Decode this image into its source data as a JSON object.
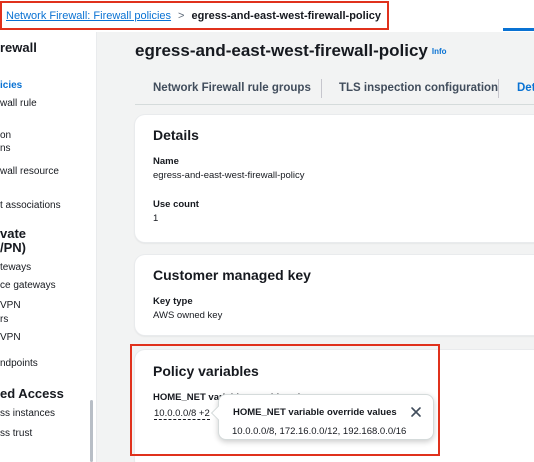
{
  "breadcrumb": {
    "parent_label": "Network Firewall: Firewall policies",
    "separator": ">",
    "current_label": "egress-and-east-west-firewall-policy"
  },
  "sidebar": {
    "items": [
      {
        "label": "rewall"
      },
      {
        "label": "icies"
      },
      {
        "label": "wall rule"
      },
      {
        "label": "on"
      },
      {
        "label": "ns"
      },
      {
        "label": "wall resource"
      },
      {
        "label": "t associations"
      },
      {
        "label": "vate"
      },
      {
        "label": "/PN)"
      },
      {
        "label": "teways"
      },
      {
        "label": "ce gateways"
      },
      {
        "label": "VPN"
      },
      {
        "label": "rs"
      },
      {
        "label": "VPN"
      },
      {
        "label": "ndpoints"
      },
      {
        "label": "ed Access"
      },
      {
        "label": "ss instances"
      },
      {
        "label": "ss trust"
      }
    ]
  },
  "page": {
    "title": "egress-and-east-west-firewall-policy",
    "info_link": "Info"
  },
  "tabs": [
    {
      "label": "Network Firewall rule groups"
    },
    {
      "label": "TLS inspection configuration"
    },
    {
      "label": "Det"
    }
  ],
  "details": {
    "title": "Details",
    "name_key": "Name",
    "name_value": "egress-and-east-west-firewall-policy",
    "use_count_key": "Use count",
    "use_count_value": "1"
  },
  "cmk": {
    "title": "Customer managed key",
    "key_type_key": "Key type",
    "key_type_value": "AWS owned key"
  },
  "policy_variables": {
    "title": "Policy variables",
    "home_net_key": "HOME_NET variable override values",
    "home_net_value": "10.0.0.0/8 +2"
  },
  "popover": {
    "title": "HOME_NET variable override values",
    "body": "10.0.0.0/8, 172.16.0.0/12, 192.168.0.0/16"
  },
  "colors": {
    "link": "#0972d3",
    "highlight": "#e0311c"
  }
}
